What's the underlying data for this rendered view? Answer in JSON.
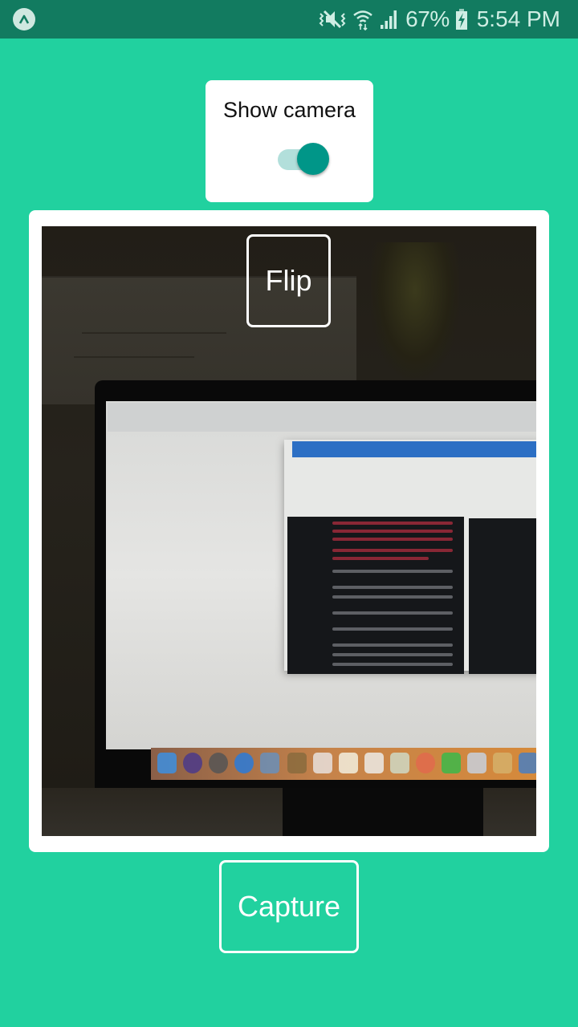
{
  "status_bar": {
    "app_icon": "expo-chevron-icon",
    "icons": [
      "vibrate-mute-icon",
      "wifi-icon",
      "cell-signal-icon",
      "battery-charging-icon"
    ],
    "battery_percent": "67%",
    "time": "5:54 PM"
  },
  "camera_toggle": {
    "label": "Show camera",
    "on": true,
    "track_color": "#b2dfdb",
    "thumb_color": "#009688"
  },
  "camera": {
    "preview": "live-camera-feed",
    "flip_label": "Flip"
  },
  "capture_label": "Capture",
  "colors": {
    "background": "#21d19f",
    "status_bar": "#127b60",
    "card": "#ffffff"
  }
}
